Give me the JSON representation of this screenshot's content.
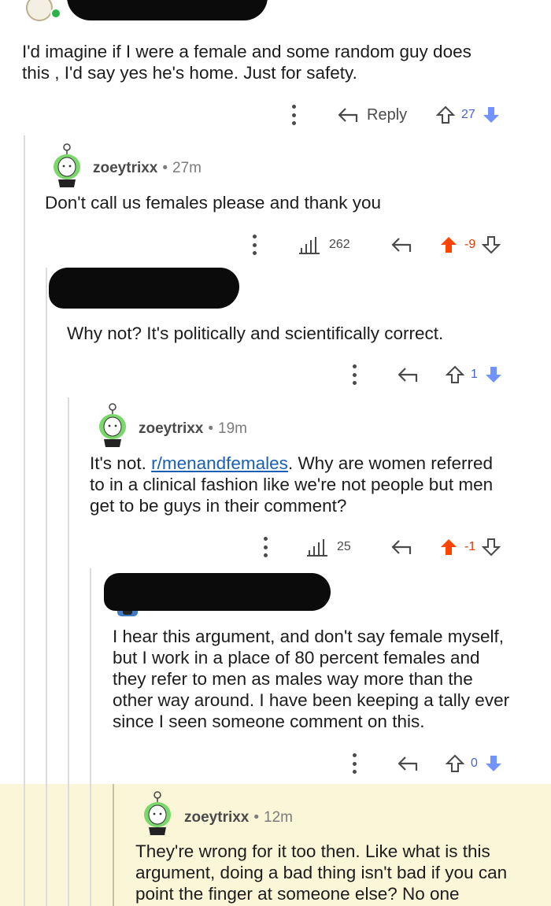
{
  "comments": [
    {
      "body": "I'd imagine if I were a female and some random guy does\nthis , I'd say yes he's home. Just for safety.",
      "reply_label": "Reply",
      "score": "27"
    },
    {
      "username": "zoeytrixx",
      "age": "27m",
      "body": "Don't call us females please and thank you",
      "views": "262",
      "score": "-9"
    },
    {
      "body": "Why not? It's politically and scientifically correct.",
      "score": "1"
    },
    {
      "username": "zoeytrixx",
      "age": "19m",
      "body_pre": "It's not. ",
      "link": "r/menandfemales",
      "body_post": ". Why are women referred\nto in a clinical fashion like we're not people but men\nget to be guys in their comment?",
      "views": "25",
      "score": "-1"
    },
    {
      "body": "I hear this argument, and don't say female myself,\nbut I work in a place of 80 percent females and\nthey refer to men as males way more than the\nother way around. I have been keeping a tally ever\nsince I seen someone comment on this.",
      "score": "0"
    },
    {
      "username": "zoeytrixx",
      "age": "12m",
      "body": "They're wrong for it too then. Like what is this\nargument, doing a bad thing isn't bad if you can\npoint the finger at someone else? No one"
    }
  ],
  "dot_separator": "•",
  "colors": {
    "upvote_active": "#ff4500",
    "downvote_active": "#7193ff",
    "icon_gray": "#7c7c7c",
    "highlight_bg": "#fbf6d8",
    "link": "#1a5fb4"
  },
  "icons": [
    "kebab-menu-icon",
    "reply-arrow-icon",
    "upvote-arrow-icon",
    "downvote-arrow-icon",
    "bar-chart-icon",
    "snoo-avatar-icon"
  ]
}
